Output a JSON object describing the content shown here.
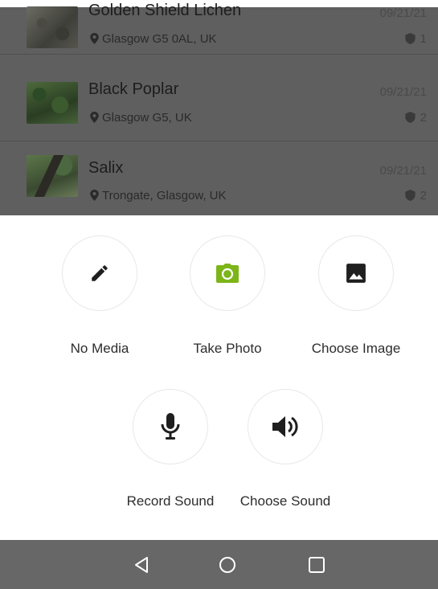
{
  "list": {
    "items": [
      {
        "name": "Golden Shield Lichen",
        "location": "Glasgow G5 0AL, UK",
        "date": "09/21/21",
        "count": "1"
      },
      {
        "name": "Black Poplar",
        "location": "Glasgow G5, UK",
        "date": "09/21/21",
        "count": "2"
      },
      {
        "name": "Salix",
        "location": "Trongate, Glasgow, UK",
        "date": "09/21/21",
        "count": "2"
      }
    ]
  },
  "media_options": [
    {
      "label": "No Media",
      "icon": "pencil-icon"
    },
    {
      "label": "Take Photo",
      "icon": "camera-icon"
    },
    {
      "label": "Choose Image",
      "icon": "image-icon"
    },
    {
      "label": "Record Sound",
      "icon": "microphone-icon"
    },
    {
      "label": "Choose Sound",
      "icon": "speaker-icon"
    }
  ],
  "colors": {
    "accent": "#7cb518",
    "overlay": "#5f5f5f",
    "navbar": "#676767"
  },
  "navbar": {
    "buttons": [
      "back-icon",
      "home-icon",
      "recents-icon"
    ]
  }
}
